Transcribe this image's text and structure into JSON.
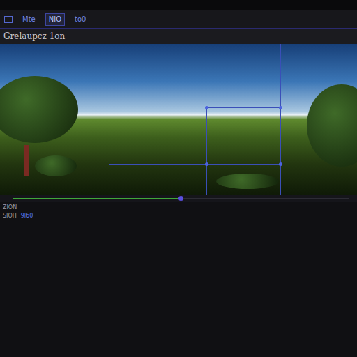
{
  "window": {
    "title": "Grelaupcz 1on"
  },
  "tabs": [
    {
      "label": "Mte",
      "selected": false
    },
    {
      "label": "NIO",
      "selected": true
    },
    {
      "label": "to0",
      "selected": false
    }
  ],
  "timeline": {
    "level": 0.5
  },
  "status_bar": {
    "line1": "ZION",
    "line2": [
      "SIOH",
      "9I60"
    ]
  }
}
